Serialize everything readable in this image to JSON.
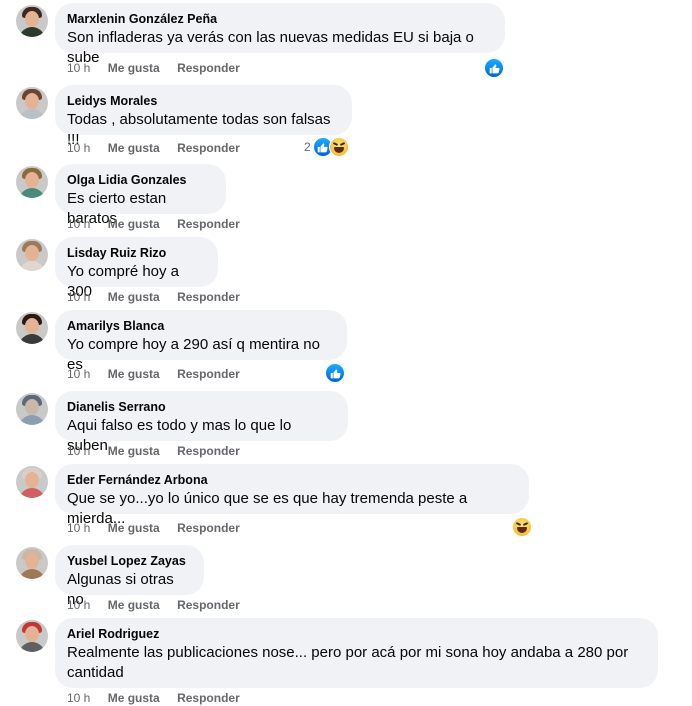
{
  "actions": {
    "like_label": "Me gusta",
    "reply_label": "Responder"
  },
  "comments": [
    {
      "author": "Marxlenin González Peña",
      "text": "Son infladeras ya verás con las nuevas medidas EU si baja o sube",
      "time": "10 h",
      "reactions": [
        "like"
      ],
      "reaction_count": ""
    },
    {
      "author": "Leidys Morales",
      "text": "Todas , absolutamente todas son falsas !!!",
      "time": "10 h",
      "reactions": [
        "like",
        "haha"
      ],
      "reaction_count": "2"
    },
    {
      "author": "Olga Lidia Gonzales",
      "text": "Es cierto estan baratos",
      "time": "10 h",
      "reactions": [],
      "reaction_count": ""
    },
    {
      "author": "Lisday Ruiz Rizo",
      "text": "Yo compré hoy a 300",
      "time": "10 h",
      "reactions": [],
      "reaction_count": ""
    },
    {
      "author": "Amarilys Blanca",
      "text": "Yo compre hoy a 290 así q mentira no es",
      "time": "10 h",
      "reactions": [
        "like"
      ],
      "reaction_count": ""
    },
    {
      "author": "Dianelis Serrano",
      "text": "Aqui falso es todo y mas lo que lo suben",
      "time": "10 h",
      "reactions": [],
      "reaction_count": ""
    },
    {
      "author": "Eder Fernández Arbona",
      "text": "Que se yo...yo lo único que se es que hay tremenda peste a mierda...",
      "time": "10 h",
      "reactions": [
        "haha"
      ],
      "reaction_count": ""
    },
    {
      "author": "Yusbel Lopez Zayas",
      "text": "Algunas si otras no",
      "time": "10 h",
      "reactions": [],
      "reaction_count": ""
    },
    {
      "author": "Ariel Rodriguez",
      "text": "Realmente las publicaciones nose... pero por acá por mi sona hoy andaba a 280 por cantidad",
      "time": "10 h",
      "reactions": [],
      "reaction_count": ""
    }
  ]
}
